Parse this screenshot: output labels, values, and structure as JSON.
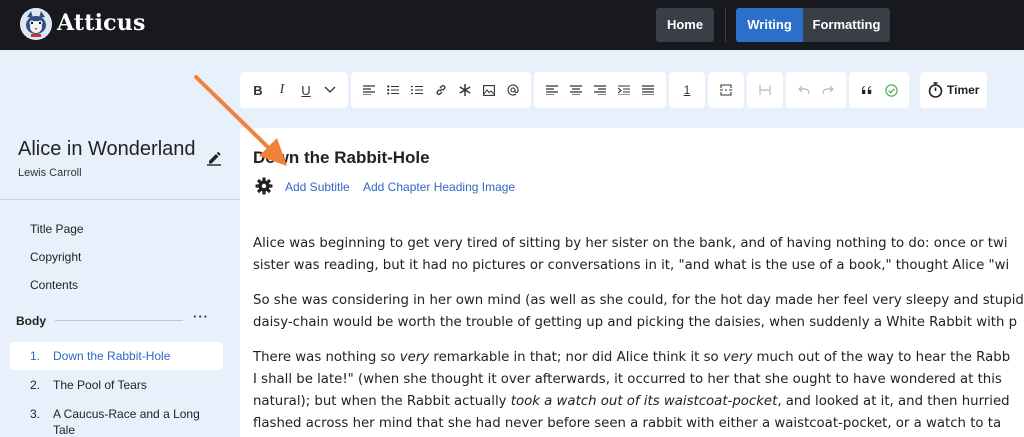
{
  "app": {
    "name": "Atticus"
  },
  "nav": {
    "home": "Home",
    "writing": "Writing",
    "formatting": "Formatting"
  },
  "toolbar": {
    "bold": "B",
    "italic": "I",
    "underline": "U",
    "page_number": "1",
    "timer": "Timer"
  },
  "sidebar": {
    "book_title": "Alice in Wonderland",
    "author": "Lewis Carroll",
    "front_matter": [
      "Title Page",
      "Copyright",
      "Contents"
    ],
    "section": "Body",
    "section_menu": "···",
    "chapters": [
      {
        "num": "1.",
        "title": "Down the Rabbit-Hole"
      },
      {
        "num": "2.",
        "title": "The Pool of Tears"
      },
      {
        "num": "3.",
        "title": "A Caucus-Race and a Long",
        "title2": "Tale"
      }
    ]
  },
  "editor": {
    "chapter_title": "Down the Rabbit-Hole",
    "add_subtitle": "Add Subtitle",
    "add_heading_image": "Add Chapter Heading Image",
    "paragraphs": [
      {
        "line1": "Alice was beginning to get very tired of sitting by her sister on the bank, and of having nothing to do: once or twi",
        "line2": "sister was reading, but it had no pictures or conversations in it, \"and what is the use of a book,\" thought Alice \"wi"
      },
      {
        "line1": "So she was considering in her own mind (as well as she could, for the hot day made her feel very sleepy and stupid",
        "line2": "daisy-chain would be worth the trouble of getting up and picking the daisies, when suddenly a White Rabbit with p"
      },
      {
        "line1a": "There was nothing so ",
        "line1b": "very",
        "line1c": " remarkable in that; nor did Alice think it so ",
        "line1d": "very",
        "line1e": " much out of the way to hear the Rabb",
        "line2": "I shall be late!\" (when she thought it over afterwards, it occurred to her that she ought to have wondered at this",
        "line3a": "natural); but when the Rabbit actually ",
        "line3b": "took a watch out of its waistcoat-pocket",
        "line3c": ", and looked at it, and then hurried",
        "line4": "flashed across her mind that she had never before seen a rabbit with either a waistcoat-pocket, or a watch to ta"
      }
    ]
  },
  "colors": {
    "accent": "#2c6fc8",
    "topbar": "#17191e",
    "background": "#e8f1fb",
    "arrow": "#f0823a",
    "check": "#4caf50"
  }
}
